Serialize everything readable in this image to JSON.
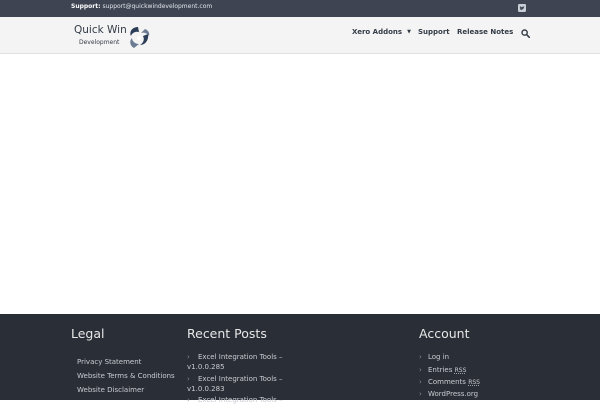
{
  "topbar": {
    "support_label": "Support:",
    "support_email": "support@quickwindevelopment.com",
    "social_icon": "twitter-icon"
  },
  "header": {
    "logo_line1": "Quick Win",
    "logo_line2": "Development",
    "nav": {
      "xero_addons": "Xero Addons",
      "support": "Support",
      "release_notes": "Release Notes"
    },
    "search_icon": "search-icon"
  },
  "footer": {
    "legal": {
      "title": "Legal",
      "items": [
        "Privacy Statement",
        "Website Terms & Conditions",
        "Website Disclaimer"
      ]
    },
    "recent_posts": {
      "title": "Recent Posts",
      "items": [
        {
          "line1": "Excel Integration Tools –",
          "line2": "v1.0.0.285"
        },
        {
          "line1": "Excel Integration Tools –",
          "line2": "v1.0.0.283"
        },
        {
          "line1": "Excel Integration Tools –"
        }
      ]
    },
    "account": {
      "title": "Account",
      "items": [
        {
          "text": "Log in"
        },
        {
          "text": "Entries",
          "abbr": "RSS"
        },
        {
          "text": "Comments",
          "abbr": "RSS"
        },
        {
          "text": "WordPress.org"
        }
      ]
    }
  },
  "colors": {
    "topbar_bg": "#3e4452",
    "header_bg": "#f4f4f4",
    "footer_bg": "#2a2e36",
    "logo_dark": "#2c3d57"
  }
}
